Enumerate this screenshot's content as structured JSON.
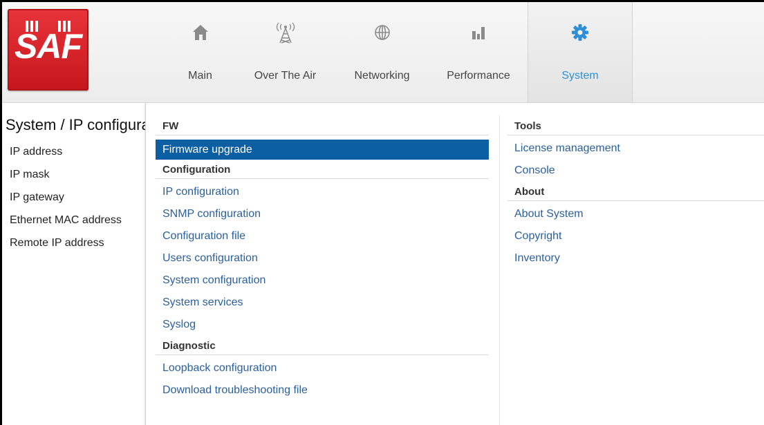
{
  "header": {
    "logo_text": "SAF",
    "nav": [
      {
        "label": "Main",
        "icon": "home-icon",
        "active": false
      },
      {
        "label": "Over The Air",
        "icon": "antenna-tower-icon",
        "active": false
      },
      {
        "label": "Networking",
        "icon": "globe-icon",
        "active": false
      },
      {
        "label": "Performance",
        "icon": "bar-chart-icon",
        "active": false
      },
      {
        "label": "System",
        "icon": "gear-icon",
        "active": true
      }
    ],
    "accent_color": "#2f8fd6",
    "logo_color": "#d71f26"
  },
  "page": {
    "title": "System / IP configuration",
    "fields": [
      "IP address",
      "IP mask",
      "IP gateway",
      "Ethernet MAC address",
      "Remote IP address"
    ]
  },
  "menu": {
    "selected_color": "#0c5fa3",
    "left": {
      "fw": {
        "title": "FW",
        "items": [
          "Firmware upgrade"
        ]
      },
      "configuration": {
        "title": "Configuration",
        "items": [
          "IP configuration",
          "SNMP configuration",
          "Configuration file",
          "Users configuration",
          "System configuration",
          "System services",
          "Syslog"
        ]
      },
      "diagnostic": {
        "title": "Diagnostic",
        "items": [
          "Loopback configuration",
          "Download troubleshooting file"
        ]
      }
    },
    "right": {
      "tools": {
        "title": "Tools",
        "items": [
          "License management",
          "Console"
        ]
      },
      "about": {
        "title": "About",
        "items": [
          "About System",
          "Copyright",
          "Inventory"
        ]
      }
    },
    "selected_item": "Firmware upgrade"
  }
}
